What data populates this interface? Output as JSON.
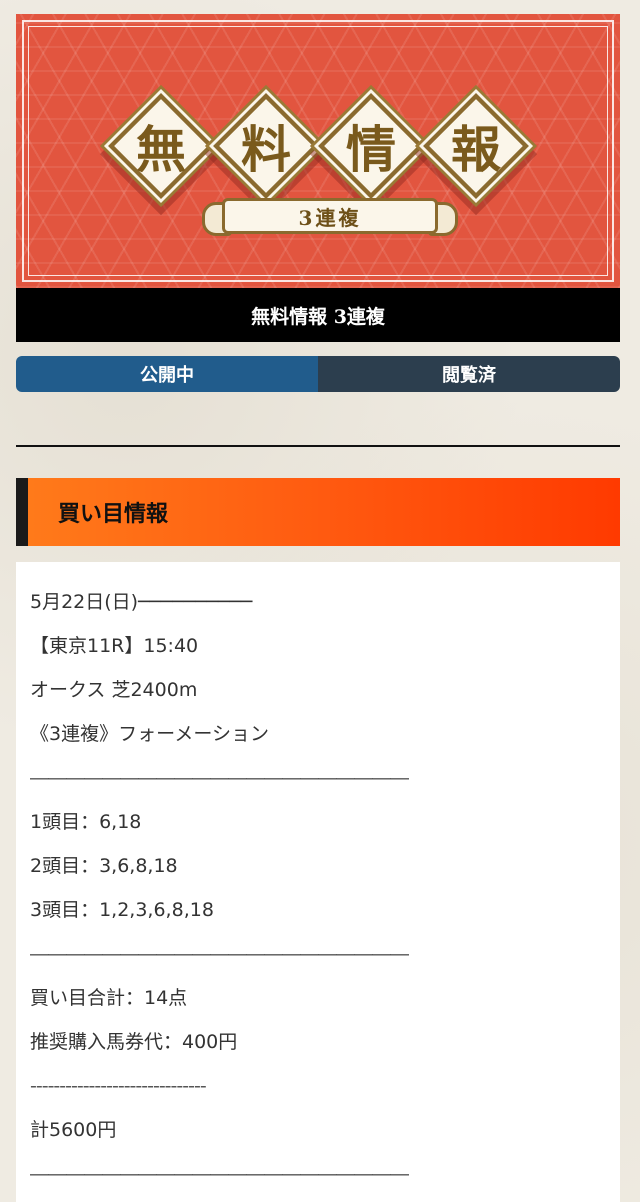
{
  "banner": {
    "chars": [
      "無",
      "料",
      "情",
      "報"
    ],
    "ribbon_text": "3連複"
  },
  "title_bar": {
    "text": "無料情報 3連複"
  },
  "tabs": [
    {
      "label": "公開中",
      "active": true
    },
    {
      "label": "閲覧済",
      "active": false
    }
  ],
  "section": {
    "title": "買い目情報"
  },
  "content": {
    "lines": [
      "5月22日(日)──────────",
      "【東京11R】15:40",
      "オークス 芝2400m",
      "《3連複》フォーメーション",
      "―――――――――――――――――――――",
      "1頭目：6,18",
      "2頭目：3,6,8,18",
      "3頭目：1,2,3,6,8,18",
      "―――――――――――――――――――――",
      "買い目合計：14点",
      "推奨購入馬券代：400円",
      "------------------------------",
      "計5600円",
      "―――――――――――――――――――――"
    ]
  },
  "colors": {
    "banner_red": "#e2553f",
    "gold": "#8a6a2e",
    "tab_active": "#215c8c",
    "tab_inactive": "#2c3e4e",
    "section_orange": "#ff5a10"
  }
}
